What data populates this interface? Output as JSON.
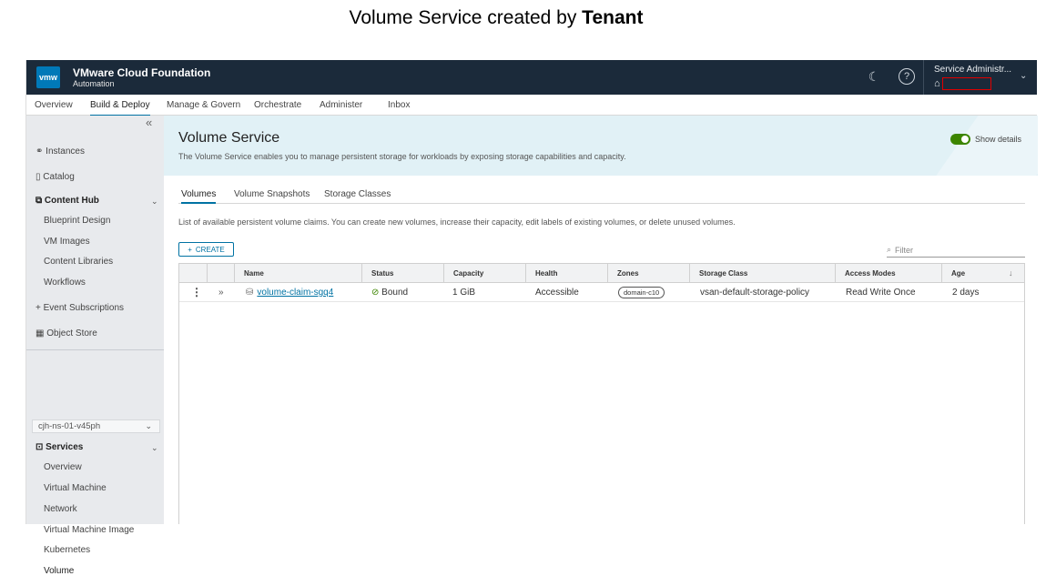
{
  "caption": {
    "prefix": "Volume Service created by ",
    "emphasis": "Tenant"
  },
  "header": {
    "logo": "vmw",
    "title": "VMware Cloud Foundation",
    "subtitle": "Automation",
    "theme_icon": "☾",
    "help_icon": "?",
    "user_name": "Service Administr...",
    "org_icon": "⌂",
    "chevron": "⌄"
  },
  "nav": {
    "items": [
      "Overview",
      "Build & Deploy",
      "Manage & Govern",
      "Orchestrate",
      "Administer",
      "Inbox"
    ],
    "active": "Build & Deploy"
  },
  "sidebar": {
    "collapse": "«",
    "instances": "Instances",
    "catalog": "Catalog",
    "content_hub": "Content Hub",
    "blueprint_design": "Blueprint Design",
    "vm_images": "VM Images",
    "content_libraries": "Content Libraries",
    "workflows": "Workflows",
    "event_subscriptions": "Event Subscriptions",
    "object_store": "Object Store",
    "namespace": "cjh-ns-01-v45ph",
    "services": "Services",
    "services_items": [
      "Overview",
      "Virtual Machine",
      "Network",
      "Virtual Machine Image",
      "Kubernetes",
      "Volume"
    ]
  },
  "banner": {
    "title": "Volume Service",
    "description": "The Volume Service enables you to manage persistent storage for workloads by exposing storage capabilities and capacity.",
    "toggle_label": "Show details",
    "toggle_on": true
  },
  "tabs": [
    "Volumes",
    "Volume Snapshots",
    "Storage Classes"
  ],
  "list_description": "List of available persistent volume claims. You can create new volumes, increase their capacity, edit labels of existing volumes, or delete unused volumes.",
  "create_label": "CREATE",
  "filter_placeholder": "Filter",
  "table": {
    "columns": [
      "Name",
      "Status",
      "Capacity",
      "Health",
      "Zones",
      "Storage Class",
      "Access Modes",
      "Age"
    ],
    "rows": [
      {
        "name": "volume-claim-sgq4",
        "status": "Bound",
        "capacity": "1 GiB",
        "health": "Accessible",
        "zones": "domain-c10",
        "storage_class": "vsan-default-storage-policy",
        "access_modes": "Read Write Once",
        "age": "2 days"
      }
    ]
  }
}
